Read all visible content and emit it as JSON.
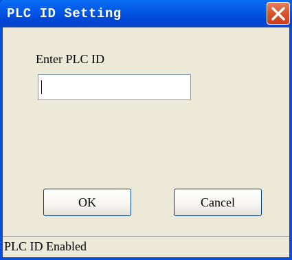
{
  "window": {
    "title": "PLC ID Setting",
    "close_icon": "close-icon"
  },
  "form": {
    "label": "Enter PLC ID",
    "input_value": "",
    "input_placeholder": ""
  },
  "buttons": {
    "ok_label": "OK",
    "cancel_label": "Cancel"
  },
  "status": {
    "text": "PLC ID Enabled"
  },
  "colors": {
    "titlebar": "#0358e6",
    "close_button": "#d8542c",
    "window_bg": "#ece9d8",
    "border": "#0a4fd6"
  }
}
